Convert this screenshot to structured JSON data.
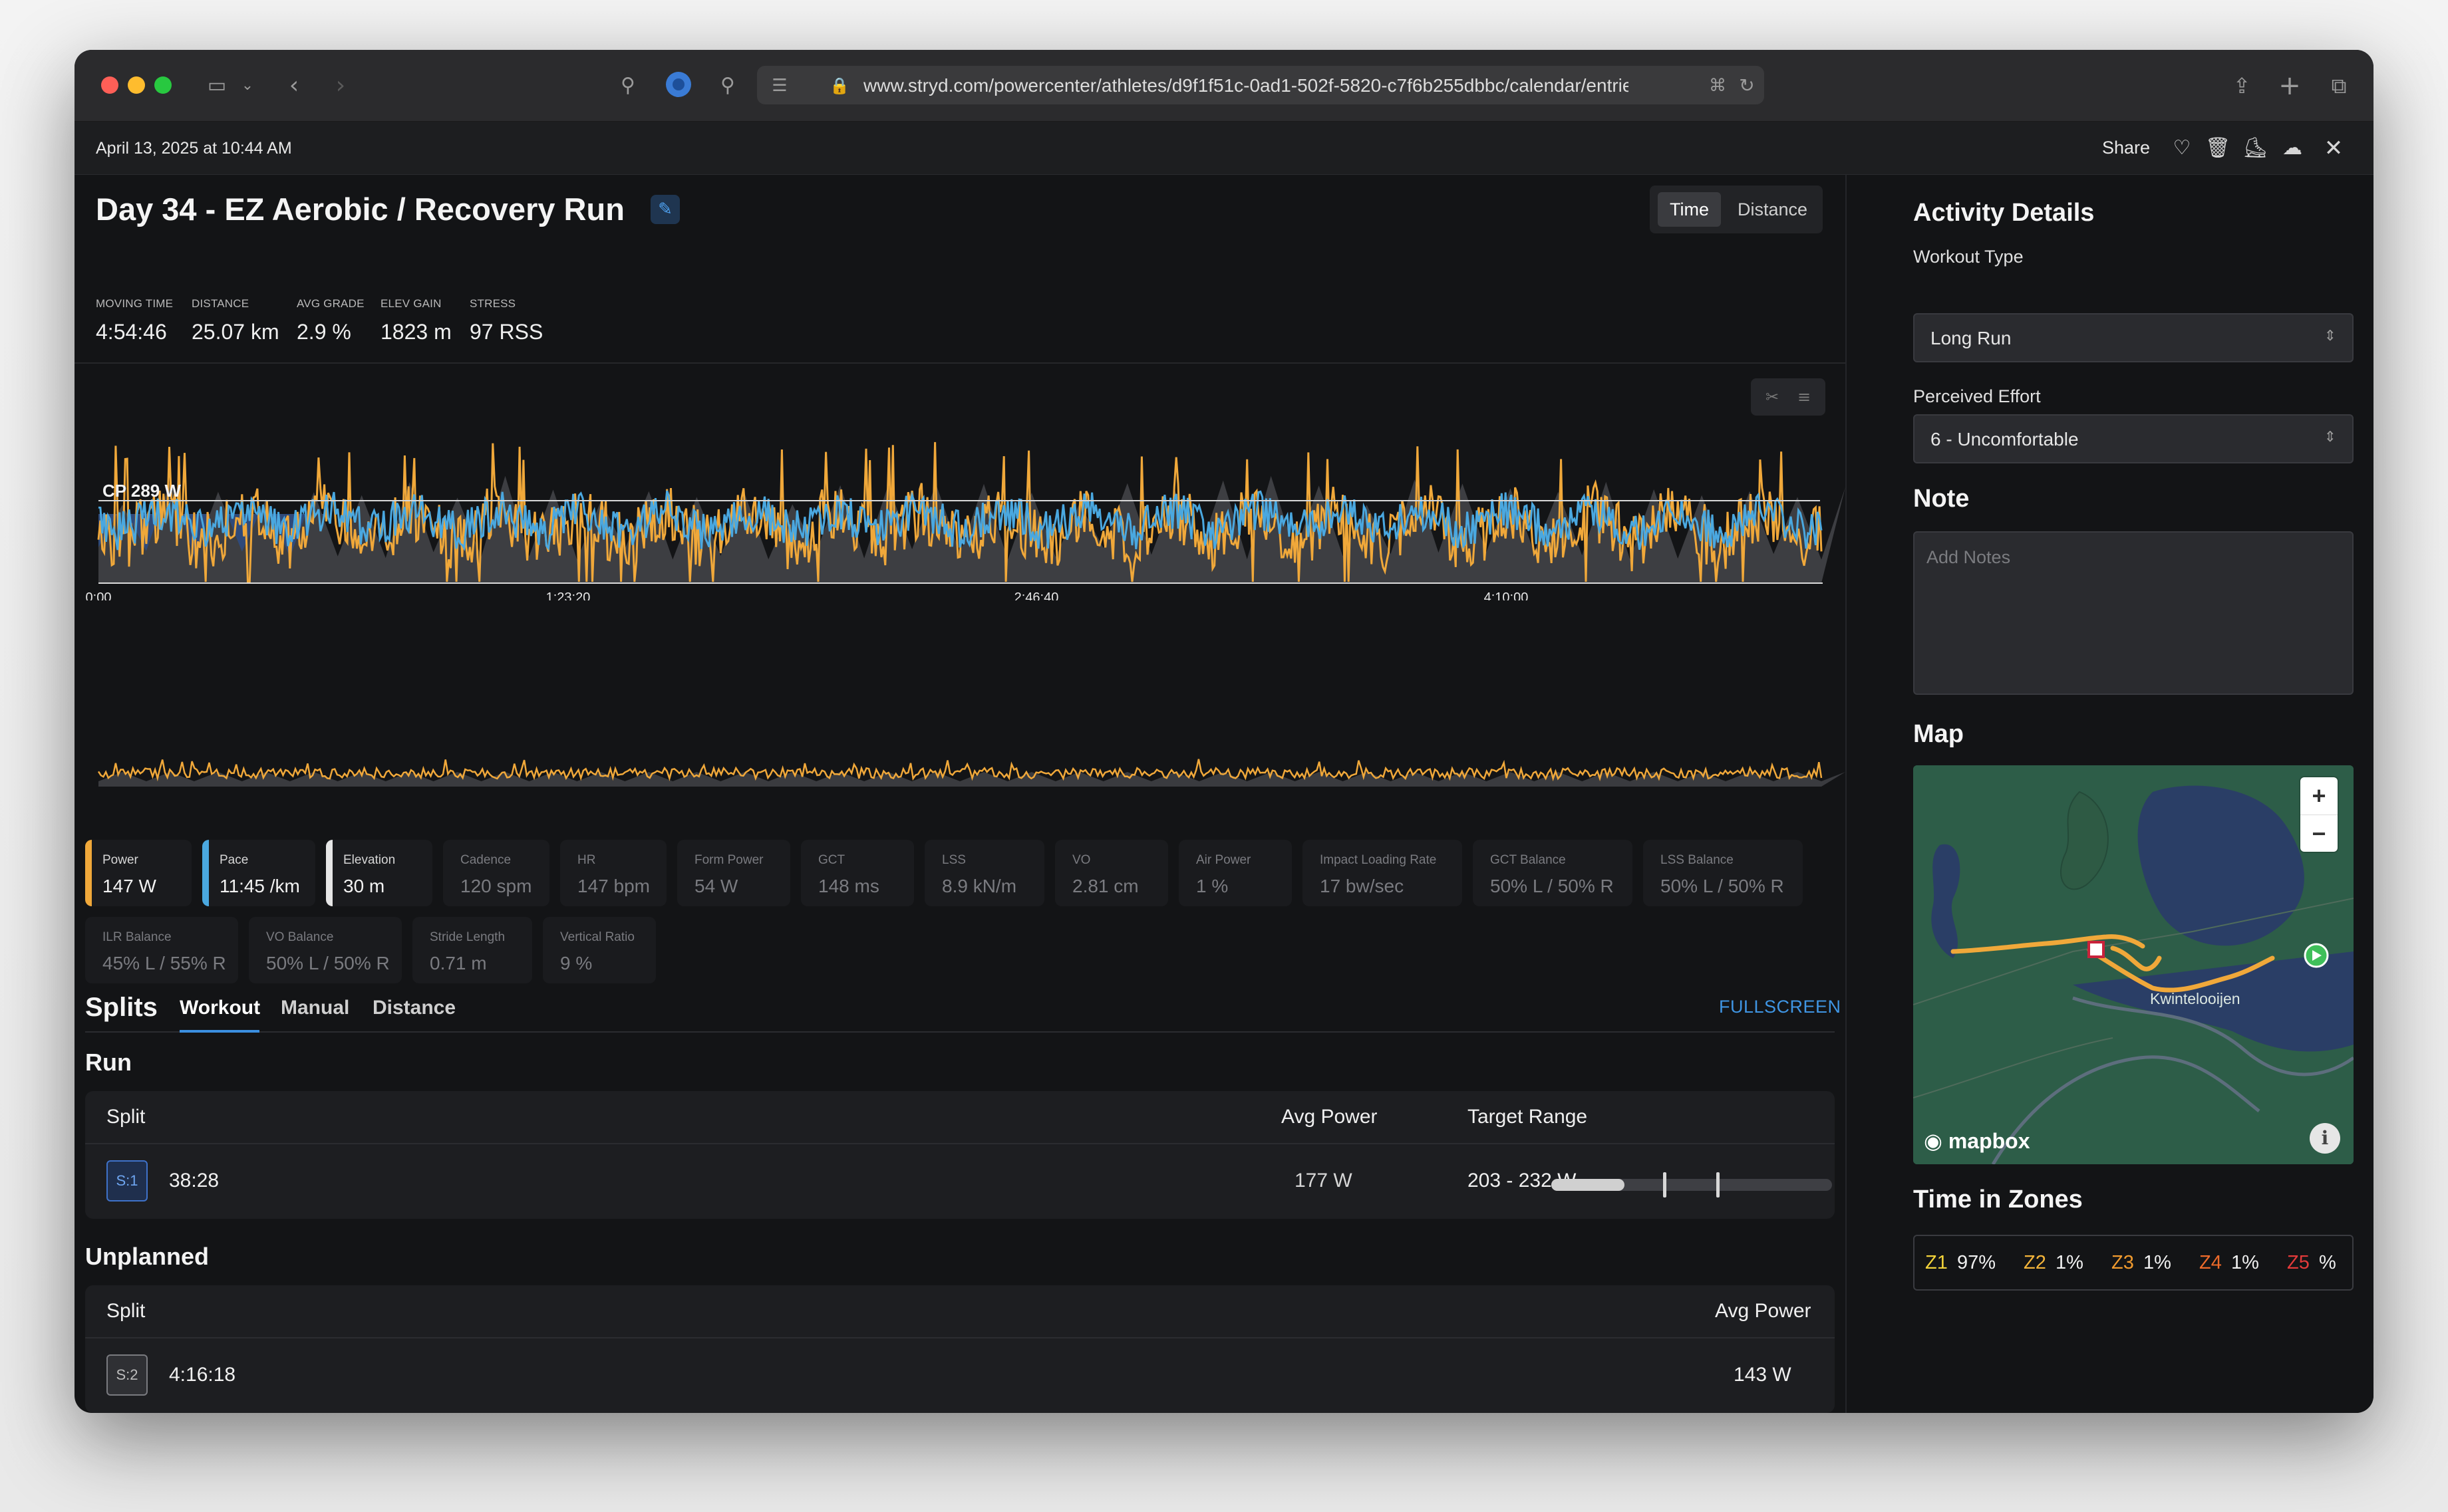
{
  "browser": {
    "url": "www.stryd.com/powercenter/athletes/d9f1f51c-0ad1-502f-5820-c7f6b255dbbc/calendar/entrie"
  },
  "appbar": {
    "date": "April 13, 2025 at 10:44 AM",
    "share": "Share"
  },
  "activity": {
    "title": "Day 34 - EZ Aerobic / Recovery Run",
    "toggle": [
      "Time",
      "Distance"
    ],
    "stats": [
      {
        "label": "MOVING TIME",
        "value": "4:54:46"
      },
      {
        "label": "DISTANCE",
        "value": "25.07 km"
      },
      {
        "label": "AVG GRADE",
        "value": "2.9 %"
      },
      {
        "label": "ELEV GAIN",
        "value": "1823 m"
      },
      {
        "label": "STRESS",
        "value": "97 RSS"
      }
    ]
  },
  "chart_data": {
    "type": "line",
    "reference_line": {
      "label": "CP 289 W",
      "value": 289
    },
    "x_ticks": [
      "0:00",
      "1:23:20",
      "2:46:40",
      "4:10:00"
    ],
    "series": [
      {
        "name": "Power",
        "color": "#f0a83a"
      },
      {
        "name": "Pace",
        "color": "#4aa8e0"
      },
      {
        "name": "Elevation",
        "color": "#3d3e42"
      }
    ]
  },
  "metrics": [
    {
      "label": "Power",
      "value": "147 W",
      "color": "#f0a83a",
      "active": true
    },
    {
      "label": "Pace",
      "value": "11:45 /km",
      "color": "#4aa8e0",
      "active": true
    },
    {
      "label": "Elevation",
      "value": "30 m",
      "color": "#e6e6e6",
      "active": true
    },
    {
      "label": "Cadence",
      "value": "120 spm"
    },
    {
      "label": "HR",
      "value": "147 bpm"
    },
    {
      "label": "Form Power",
      "value": "54 W"
    },
    {
      "label": "GCT",
      "value": "148 ms"
    },
    {
      "label": "LSS",
      "value": "8.9 kN/m"
    },
    {
      "label": "VO",
      "value": "2.81 cm"
    },
    {
      "label": "Air Power",
      "value": "1 %"
    },
    {
      "label": "Impact Loading Rate",
      "value": "17 bw/sec"
    },
    {
      "label": "GCT Balance",
      "value": "50% L / 50% R"
    },
    {
      "label": "LSS Balance",
      "value": "50% L / 50% R"
    },
    {
      "label": "ILR Balance",
      "value": "45% L / 55% R"
    },
    {
      "label": "VO Balance",
      "value": "50% L / 50% R"
    },
    {
      "label": "Stride Length",
      "value": "0.71 m"
    },
    {
      "label": "Vertical Ratio",
      "value": "9 %"
    }
  ],
  "splits": {
    "heading": "Splits",
    "tabs": [
      "Workout",
      "Manual",
      "Distance"
    ],
    "fullscreen": "FULLSCREEN",
    "run": {
      "heading": "Run",
      "columns": [
        "Split",
        "Avg Power",
        "Target Range"
      ],
      "rows": [
        {
          "badge": "S:1",
          "time": "38:28",
          "avg_power": "177 W",
          "target": "203 - 232 W"
        }
      ]
    },
    "unplanned": {
      "heading": "Unplanned",
      "columns": [
        "Split",
        "Avg Power"
      ],
      "rows": [
        {
          "badge": "S:2",
          "time": "4:16:18",
          "avg_power": "143 W"
        }
      ]
    }
  },
  "sidebar": {
    "heading": "Activity Details",
    "workout_type_label": "Workout Type",
    "workout_type": "Long Run",
    "effort_label": "Perceived Effort",
    "effort": "6 - Uncomfortable",
    "note_heading": "Note",
    "note_placeholder": "Add Notes",
    "map_heading": "Map",
    "map_place": "Kwintelooijen",
    "map_brand": "mapbox",
    "zones_heading": "Time in Zones",
    "zones": [
      {
        "name": "Z1",
        "value": "97%",
        "color": "#f2d23a"
      },
      {
        "name": "Z2",
        "value": "1%",
        "color": "#f4b43a"
      },
      {
        "name": "Z3",
        "value": "1%",
        "color": "#f09a2e"
      },
      {
        "name": "Z4",
        "value": "1%",
        "color": "#ec6a2a"
      },
      {
        "name": "Z5",
        "value": "%",
        "color": "#e23a3a"
      }
    ]
  }
}
